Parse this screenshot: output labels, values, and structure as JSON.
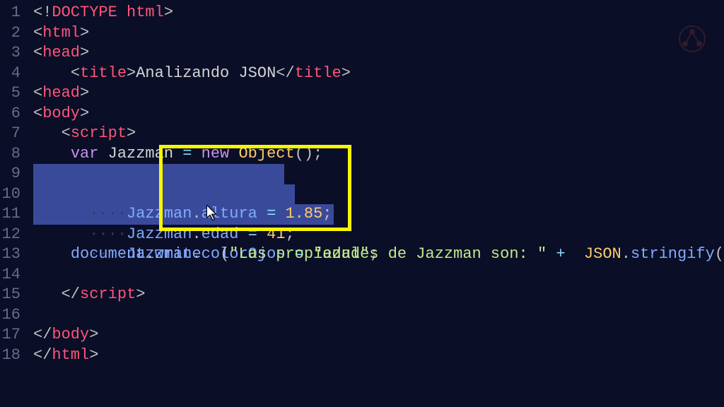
{
  "lines": {
    "numbers": [
      "1",
      "2",
      "3",
      "4",
      "5",
      "6",
      "7",
      "8",
      "9",
      "10",
      "11",
      "12",
      "13",
      "14",
      "15",
      "16",
      "17",
      "18"
    ],
    "l1": {
      "open": "<",
      "excl": "!",
      "tag": "DOCTYPE html",
      "close": ">"
    },
    "l2": {
      "open": "<",
      "tag": "html",
      "close": ">"
    },
    "l3": {
      "open": "<",
      "tag": "head",
      "close": ">"
    },
    "l4": {
      "indent": "    ",
      "open1": "<",
      "tag1": "title",
      "close1": ">",
      "text": "Analizando JSON",
      "open2": "</",
      "tag2": "title",
      "close2": ">"
    },
    "l5": {
      "open": "<",
      "tag": "head",
      "close": ">"
    },
    "l6": {
      "open": "<",
      "tag": "body",
      "close": ">"
    },
    "l7": {
      "indent": "   ",
      "open": "<",
      "tag": "script",
      "close": ">"
    },
    "l8": {
      "indent": "    ",
      "kw": "var",
      "sp": " ",
      "name": "Jazzman",
      "eq": " = ",
      "new": "new",
      "sp2": " ",
      "cls": "Object",
      "paren": "()",
      "semi": ";"
    },
    "l9": {
      "dots": "····",
      "obj": "Jazzman",
      "dot": ".",
      "prop": "altura",
      "eq": " = ",
      "val": "1.85",
      "semi": ";"
    },
    "l10": {
      "dots": "····",
      "obj": "Jazzman",
      "dot": ".",
      "prop": "edad",
      "eq": " = ",
      "val": "41",
      "semi": ";"
    },
    "l11": {
      "dots": "····",
      "obj": "Jazzman",
      "dot": ".",
      "prop": "colorOjos",
      "eq": " = ",
      "q1": "\"",
      "val": "azul",
      "q2": "\"",
      "semi": ";"
    },
    "l13": {
      "indent": "    ",
      "obj": "document",
      "dot": ".",
      "method": "write",
      "sp": "  ",
      "paren1": "(",
      "q1": "\"",
      "str": "Las propiedades de Jazzman son: ",
      "q2": "\"",
      "plus": " +  ",
      "json": "JSON",
      "dot2": ".",
      "method2": "stringify",
      "paren2": "("
    },
    "l15": {
      "indent": "   ",
      "open": "</",
      "tag": "script",
      "close": ">"
    },
    "l17": {
      "open": "</",
      "tag": "body",
      "close": ">"
    },
    "l18": {
      "open": "</",
      "tag": "html",
      "close": ">"
    }
  }
}
